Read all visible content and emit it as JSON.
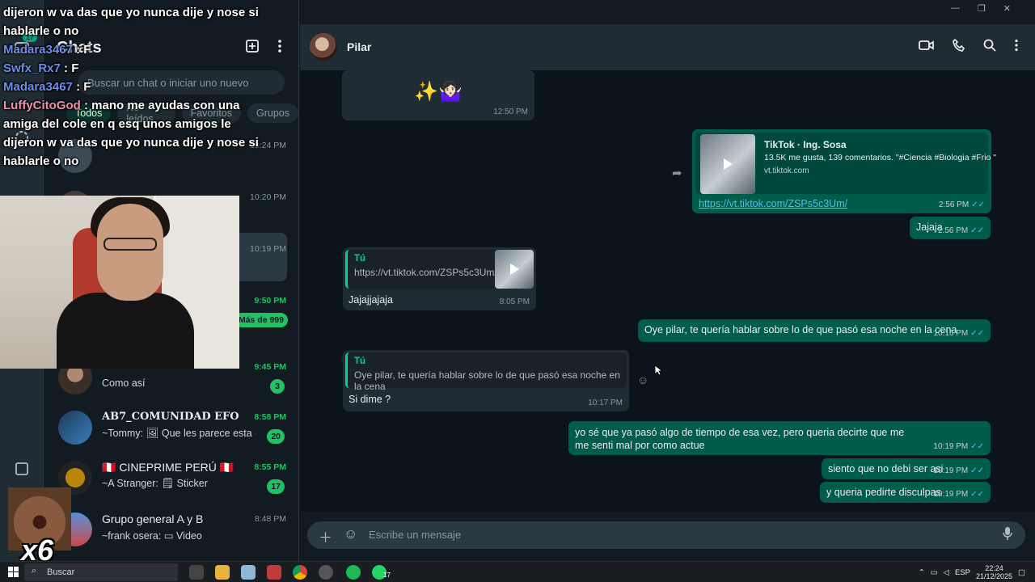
{
  "window": {
    "controls": [
      "—",
      "❐",
      "✕"
    ]
  },
  "rail": {
    "badge": "17"
  },
  "panel": {
    "title": "Chats",
    "search_placeholder": "Buscar un chat o iniciar uno nuevo",
    "filters": [
      "Todos",
      "No leídos",
      "Favoritos",
      "Grupos"
    ]
  },
  "chat_list": [
    {
      "name": "",
      "preview": "",
      "time": "10:24 PM"
    },
    {
      "name": "",
      "preview": "",
      "time": "10:20 PM"
    },
    {
      "name": "",
      "preview": "",
      "time": "10:19 PM"
    },
    {
      "name": "",
      "preview": "",
      "time": "9:50 PM",
      "count": "Más de 999"
    },
    {
      "name": "",
      "preview": "Como así",
      "time": "9:45 PM",
      "count": "3"
    },
    {
      "name": "AB7_COMUNIDAD EFOO...",
      "preview": "~Tommy: 🖼 Que les parece esta c...",
      "time": "8:58 PM",
      "count": "20"
    },
    {
      "name": "🇵🇪 CINEPRIME PERÚ 🇵🇪",
      "preview": "~A Stranger: 🗒 Sticker",
      "time": "8:55 PM",
      "count": "17"
    },
    {
      "name": "Grupo general A y B",
      "preview": "~frank osera: ▭ Video",
      "time": "8:48 PM"
    }
  ],
  "conversation": {
    "contact": "Pilar",
    "messages": {
      "m1": {
        "text": "✨🤷🏻‍♀️",
        "time": "12:50 PM"
      },
      "m2": {
        "title": "TikTok · Ing. Sosa",
        "desc": "13.5K me gusta, 139 comentarios. \"#Ciencia #Biologia #Frio \"",
        "domain": "vt.tiktok.com",
        "link": "https://vt.tiktok.com/ZSPs5c3Um/",
        "time": "2:56 PM"
      },
      "m3": {
        "text": "Jajaja",
        "time": "2:56 PM"
      },
      "m4": {
        "quote_author": "Tú",
        "quote_text": "https://vt.tiktok.com/ZSPs5c3Um/",
        "text": "Jajajjajaja",
        "time": "8:05 PM"
      },
      "m5": {
        "text": "Oye pilar, te quería hablar sobre lo de que pasó esa noche en la cena",
        "time": "10:16 PM"
      },
      "m6": {
        "quote_author": "Tú",
        "quote_text": "Oye pilar, te quería hablar sobre lo de que pasó esa noche en la cena",
        "text": "Si dime ?",
        "time": "10:17 PM"
      },
      "m7": {
        "text": "yo sé que ya pasó algo de tiempo de esa vez, pero queria decirte que me me senti mal por como actue",
        "time": "10:19 PM"
      },
      "m8": {
        "text": "siento que no debi ser asi",
        "time": "10:19 PM"
      },
      "m9": {
        "text": "y queria pedirte disculpas",
        "time": "10:19 PM"
      }
    }
  },
  "composer": {
    "placeholder": "Escribe un mensaje"
  },
  "taskbar": {
    "search": "Buscar",
    "lang": "ESP",
    "time": "22:24",
    "date": "21/12/2025",
    "wa_badge": "17"
  },
  "overlay": {
    "lines": [
      {
        "user": "",
        "text": "dijeron w va das que yo nunca dije y nose si hablarle o no"
      },
      {
        "user": "Madara3467",
        "text": " : F"
      },
      {
        "user": "Swfx_Rx7",
        "text": " : F"
      },
      {
        "user": "Madara3467",
        "text": " : F"
      },
      {
        "user": "LuffyCitoGod",
        "text": " : mano me ayudas con una amiga del cole en q esq unos amigos le dijeron w va das que yo nunca dije y nose si hablarle o no"
      }
    ],
    "multiplier": "x6"
  }
}
